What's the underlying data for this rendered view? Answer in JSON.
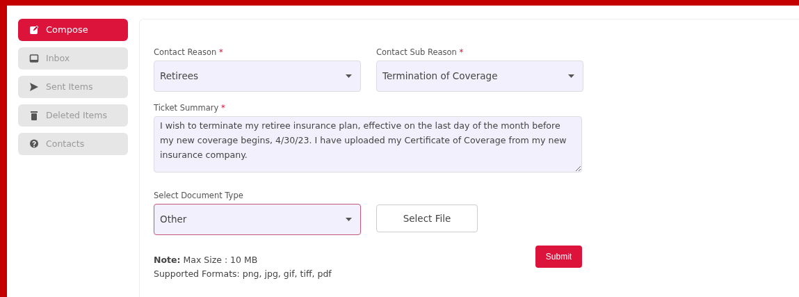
{
  "sidebar": {
    "items": [
      {
        "label": "Compose",
        "kind": "compose",
        "selected": true
      },
      {
        "label": "Inbox",
        "kind": "inbox",
        "selected": false
      },
      {
        "label": "Sent Items",
        "kind": "send",
        "selected": false
      },
      {
        "label": "Deleted Items",
        "kind": "trash",
        "selected": false
      },
      {
        "label": "Contacts",
        "kind": "question",
        "selected": false
      }
    ]
  },
  "form": {
    "contact_reason": {
      "label": "Contact Reason",
      "required_mark": "*",
      "value": "Retirees",
      "focused": false
    },
    "contact_sub_reason": {
      "label": "Contact Sub Reason",
      "required_mark": "*",
      "value": "Termination of Coverage",
      "focused": false
    },
    "ticket_summary": {
      "label": "Ticket Summary",
      "required_mark": "*",
      "value": "I wish to terminate my retiree insurance plan, effective on the last day of the month before my new coverage begins, 4/30/23. I have uploaded my Certificate of Coverage from my new insurance company."
    },
    "document_type": {
      "label": "Select Document Type",
      "value": "Other",
      "focused": true
    },
    "select_file_button": "Select File",
    "note": "**Note:** Max Size : 10 MB",
    "supported_formats": "Supported Formats: png, jpg, gif, tiff, pdf",
    "submit_button": "Submit"
  }
}
